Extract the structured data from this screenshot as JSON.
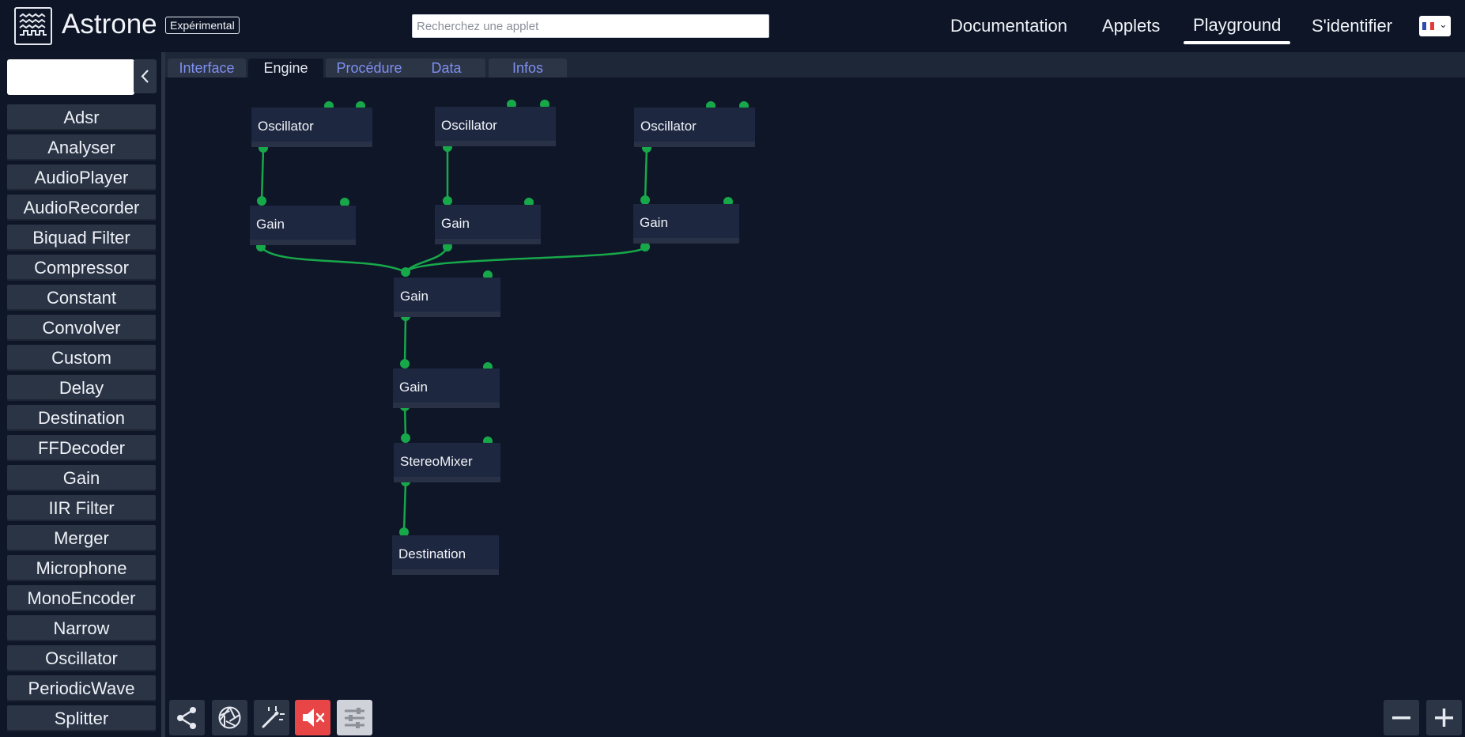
{
  "header": {
    "app_title": "Astrone",
    "badge": "Expérimental",
    "search_placeholder": "Recherchez une applet",
    "nav": [
      "Documentation",
      "Applets",
      "Playground",
      "S'identifier"
    ],
    "active_nav": "Playground",
    "language_flag": "fr-flag-icon"
  },
  "sidebar": {
    "filter_value": "",
    "items": [
      "Adsr",
      "Analyser",
      "AudioPlayer",
      "AudioRecorder",
      "Biquad Filter",
      "Compressor",
      "Constant",
      "Convolver",
      "Custom",
      "Delay",
      "Destination",
      "FFDecoder",
      "Gain",
      "IIR Filter",
      "Merger",
      "Microphone",
      "MonoEncoder",
      "Narrow",
      "Oscillator",
      "PeriodicWave",
      "Splitter"
    ]
  },
  "tabs": [
    "Interface",
    "Engine",
    "Procédure",
    "Data",
    "Infos"
  ],
  "active_tab": "Engine",
  "graph": {
    "nodes": [
      "Oscillator",
      "Oscillator",
      "Oscillator",
      "Gain",
      "Gain",
      "Gain",
      "Gain",
      "Gain",
      "StereoMixer",
      "Destination"
    ]
  },
  "toolbar": {
    "icons": [
      "share-icon",
      "aperture-icon",
      "magic-wand-icon",
      "mute-icon",
      "sliders-icon",
      "zoom-out-icon",
      "zoom-in-icon"
    ]
  },
  "colors": {
    "background": "#0f1628",
    "node": "#1d2740",
    "wire": "#17a84a",
    "tab_link": "#7f8ff0",
    "mute": "#e84547"
  }
}
